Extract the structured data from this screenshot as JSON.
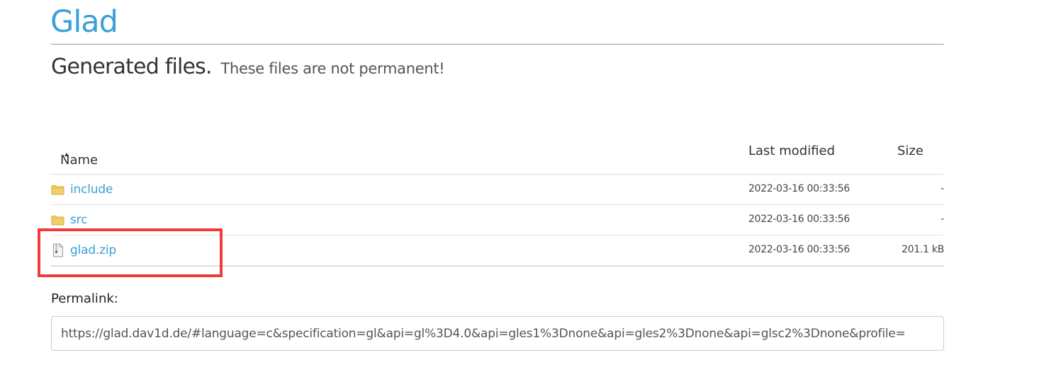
{
  "header": {
    "title": "Glad",
    "subtitle": "Generated files.",
    "subtitle_note": "These files are not permanent!"
  },
  "listing": {
    "columns": {
      "name": "Name",
      "last_modified": "Last modified",
      "size": "Size"
    },
    "rows": [
      {
        "name": "include",
        "type": "folder",
        "modified": "2022-03-16 00:33:56",
        "size": "-"
      },
      {
        "name": "src",
        "type": "folder",
        "modified": "2022-03-16 00:33:56",
        "size": "-"
      },
      {
        "name": "glad.zip",
        "type": "zip-file",
        "modified": "2022-03-16 00:33:56",
        "size": "201.1 kB"
      }
    ]
  },
  "permalink": {
    "label": "Permalink:",
    "value": "https://glad.dav1d.de/#language=c&specification=gl&api=gl%3D4.0&api=gles1%3Dnone&api=gles2%3Dnone&api=glsc2%3Dnone&profile="
  },
  "colors": {
    "link": "#3aa0d8",
    "highlight": "#ef3b3b",
    "folder_icon": "#f0c75e"
  }
}
